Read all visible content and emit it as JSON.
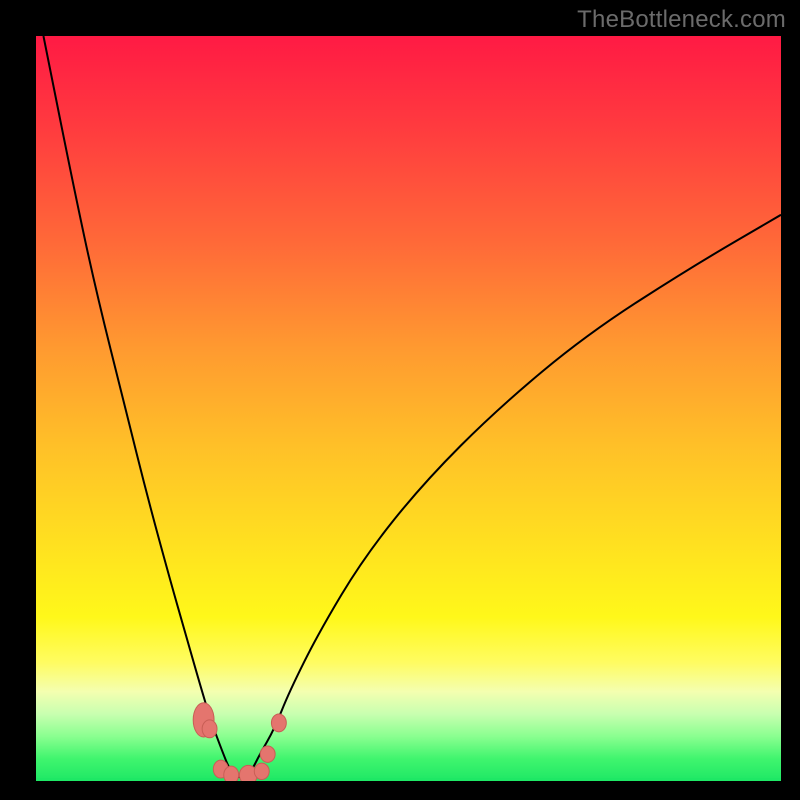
{
  "watermark": "TheBottleneck.com",
  "colors": {
    "bg": "#000000",
    "curve": "#000000",
    "marker": "#e4756e",
    "marker_stroke": "#c85e55",
    "gradient_top": "#ff1a44",
    "gradient_bottom": "#1ee865"
  },
  "chart_data": {
    "type": "line",
    "title": "",
    "xlabel": "",
    "ylabel": "",
    "xlim": [
      0,
      100
    ],
    "ylim": [
      0,
      100
    ],
    "grid": false,
    "legend": false,
    "series": [
      {
        "name": "curve",
        "x": [
          1,
          5,
          8,
          12,
          15,
          18,
          20,
          22,
          23.5,
          25,
          26,
          27,
          28,
          29,
          30,
          32,
          34,
          38,
          44,
          52,
          62,
          74,
          88,
          100
        ],
        "y": [
          100,
          80,
          66,
          50,
          38,
          27,
          20,
          13,
          8,
          4,
          1.5,
          0.5,
          0.5,
          1.5,
          3.5,
          7,
          12,
          20,
          30,
          40,
          50,
          60,
          69,
          76
        ]
      }
    ],
    "markers": [
      {
        "x": 22.5,
        "y": 8.2,
        "rx": 1.4,
        "ry": 2.3
      },
      {
        "x": 23.3,
        "y": 7.0,
        "rx": 1.0,
        "ry": 1.2
      },
      {
        "x": 24.8,
        "y": 1.6,
        "rx": 1.0,
        "ry": 1.2
      },
      {
        "x": 26.2,
        "y": 0.8,
        "rx": 1.0,
        "ry": 1.2
      },
      {
        "x": 28.5,
        "y": 0.8,
        "rx": 1.2,
        "ry": 1.3
      },
      {
        "x": 30.3,
        "y": 1.3,
        "rx": 1.0,
        "ry": 1.1
      },
      {
        "x": 31.1,
        "y": 3.6,
        "rx": 1.0,
        "ry": 1.1
      },
      {
        "x": 32.6,
        "y": 7.8,
        "rx": 1.0,
        "ry": 1.2
      }
    ]
  }
}
